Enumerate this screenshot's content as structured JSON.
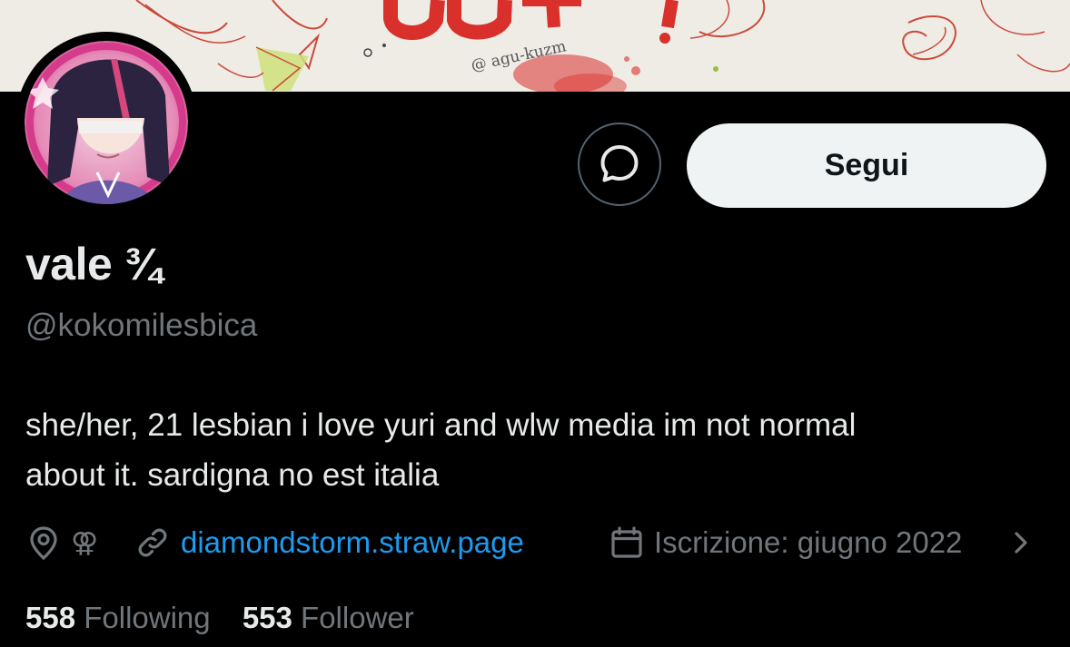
{
  "banner": {
    "watermark": "@ agu-kuzm"
  },
  "profile": {
    "display_name": "vale ¾",
    "handle": "@kokomilesbica",
    "bio_lines": [
      "she/her, 21 lesbian i love yuri and wlw media im not normal",
      "about it. sardigna no est italia"
    ]
  },
  "actions": {
    "follow_label": "Segui"
  },
  "meta": {
    "location_icon": "location-pin-icon",
    "location_symbol": "⚢",
    "link_icon": "link-icon",
    "link_text": "diamondstorm.straw.page",
    "joined_icon": "calendar-icon",
    "joined_text": "Iscrizione: giugno 2022",
    "chevron_icon": "chevron-right-icon"
  },
  "stats": {
    "following_count": "558",
    "following_label": "Following",
    "followers_count": "553",
    "followers_label": "Follower"
  },
  "colors": {
    "background": "#000000",
    "primary_text": "#e7e9ea",
    "secondary_text": "#71767b",
    "link": "#1d9bf0",
    "follow_button_bg": "#eff3f4",
    "banner_red": "#d9302b"
  }
}
